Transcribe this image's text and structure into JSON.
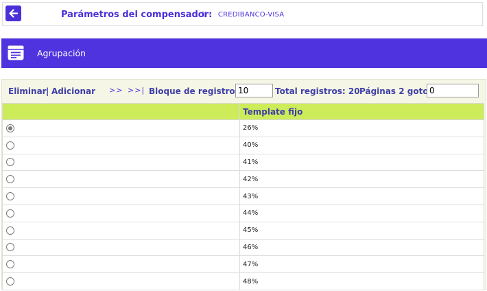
{
  "top": {
    "label": "Parámetros del compensador:",
    "value": "1 -   CREDIBANCO-VISA"
  },
  "header": {
    "title": "Agrupación"
  },
  "toolbar": {
    "delete_label": "Eliminar",
    "separator": "|",
    "add_label": "Adicionar",
    "next_label": ">>",
    "last_label": ">>|",
    "block_label": "Bloque de registros:",
    "block_value": "10",
    "total_label": "Total registros: 20",
    "pages_label": "Páginas 2 goto:",
    "goto_value": "0"
  },
  "table": {
    "columns": [
      "",
      "Template fijo"
    ],
    "rows": [
      {
        "selected": true,
        "value": "26%"
      },
      {
        "selected": false,
        "value": "40%"
      },
      {
        "selected": false,
        "value": "41%"
      },
      {
        "selected": false,
        "value": "42%"
      },
      {
        "selected": false,
        "value": "43%"
      },
      {
        "selected": false,
        "value": "44%"
      },
      {
        "selected": false,
        "value": "45%"
      },
      {
        "selected": false,
        "value": "46%"
      },
      {
        "selected": false,
        "value": "47%"
      },
      {
        "selected": false,
        "value": "48%"
      }
    ]
  },
  "colors": {
    "accent": "#4e33de",
    "table_header": "#cdec5a",
    "panel_bg": "#f5f6e6"
  }
}
